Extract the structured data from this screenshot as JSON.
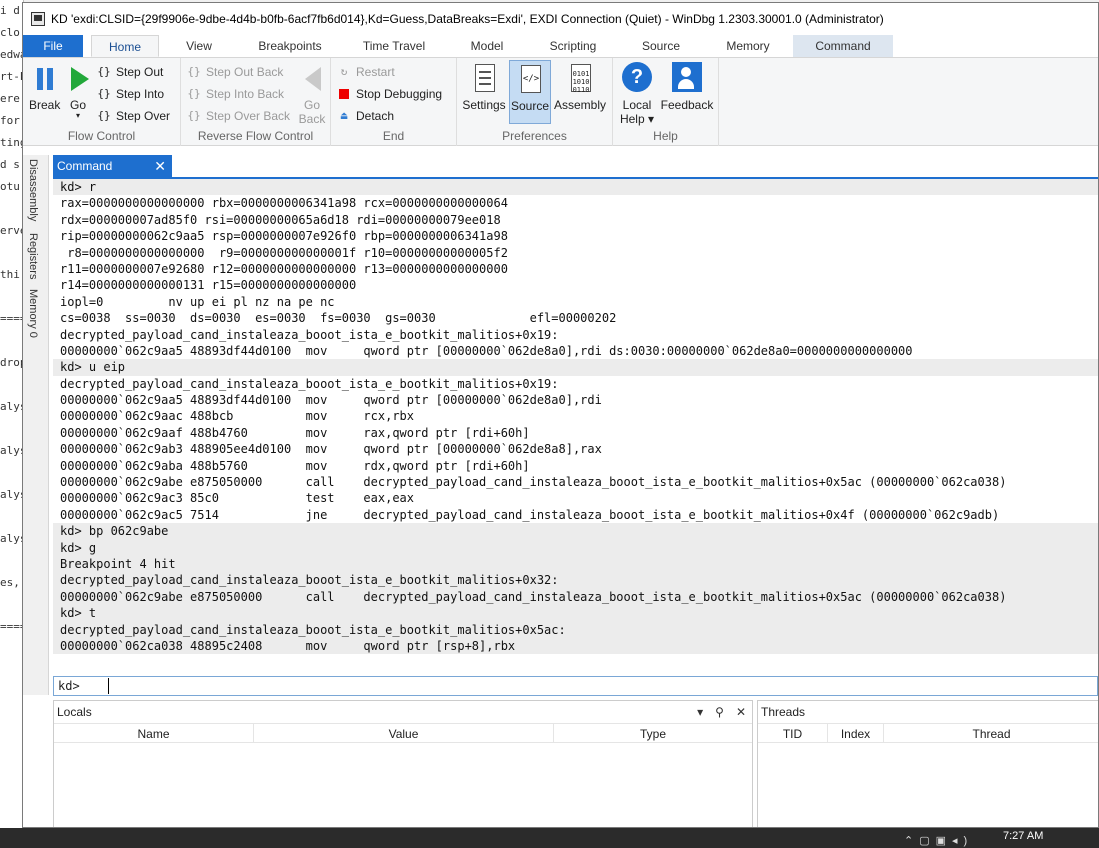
{
  "background_window": {
    "lines": [
      "i d",
      "clo",
      "edwa",
      "rt-E",
      "ere",
      "for",
      "ting",
      "d s",
      "otu",
      "",
      "erve",
      "",
      "thi",
      "",
      "====",
      "",
      "drop",
      "",
      "alys",
      "",
      "alys",
      "",
      "alys",
      "",
      "alys",
      "",
      "es,",
      "",
      "===="
    ]
  },
  "window": {
    "title": "KD 'exdi:CLSID={29f9906e-9dbe-4d4b-b0fb-6acf7fb6d014},Kd=Guess,DataBreaks=Exdi', EXDI Connection (Quiet) - WinDbg 1.2303.30001.0 (Administrator)"
  },
  "ribbon_tabs": [
    "File",
    "Home",
    "View",
    "Breakpoints",
    "Time Travel",
    "Model",
    "Scripting",
    "Source",
    "Memory",
    "Command"
  ],
  "ribbon": {
    "flow_control": {
      "label": "Flow Control",
      "break": "Break",
      "go": "Go",
      "step_out": "Step Out",
      "step_into": "Step Into",
      "step_over": "Step Over"
    },
    "reverse_flow_control": {
      "label": "Reverse Flow Control",
      "step_out_back": "Step Out Back",
      "step_into_back": "Step Into Back",
      "step_over_back": "Step Over Back",
      "go_back_1": "Go",
      "go_back_2": "Back"
    },
    "end": {
      "label": "End",
      "restart": "Restart",
      "stop_debugging": "Stop Debugging",
      "detach": "Detach"
    },
    "preferences": {
      "label": "Preferences",
      "settings": "Settings",
      "source": "Source",
      "assembly": "Assembly"
    },
    "help": {
      "label": "Help",
      "local_help_1": "Local",
      "local_help_2": "Help ▾",
      "feedback": "Feedback"
    }
  },
  "side_tabs": [
    "Disassembly",
    "Registers",
    "Memory 0"
  ],
  "command_panel": {
    "title": "Command",
    "prompt": "kd>",
    "output": [
      {
        "t": "kd> r",
        "cmd": true
      },
      {
        "t": "rax=0000000000000000 rbx=0000000006341a98 rcx=0000000000000064",
        "cmd": false
      },
      {
        "t": "rdx=000000007ad85f0 rsi=00000000065a6d18 rdi=00000000079ee018",
        "cmd": false
      },
      {
        "t": "rip=00000000062c9aa5 rsp=0000000007e926f0 rbp=0000000006341a98",
        "cmd": false
      },
      {
        "t": " r8=0000000000000000  r9=000000000000001f r10=00000000000005f2",
        "cmd": false
      },
      {
        "t": "r11=0000000007e92680 r12=0000000000000000 r13=0000000000000000",
        "cmd": false
      },
      {
        "t": "r14=0000000000000131 r15=0000000000000000",
        "cmd": false
      },
      {
        "t": "iopl=0         nv up ei pl nz na pe nc",
        "cmd": false
      },
      {
        "t": "cs=0038  ss=0030  ds=0030  es=0030  fs=0030  gs=0030             efl=00000202",
        "cmd": false
      },
      {
        "t": "decrypted_payload_cand_instaleaza_booot_ista_e_bootkit_malitios+0x19:",
        "cmd": false
      },
      {
        "t": "00000000`062c9aa5 48893df44d0100  mov     qword ptr [00000000`062de8a0],rdi ds:0030:00000000`062de8a0=0000000000000000",
        "cmd": false
      },
      {
        "t": "kd> u eip",
        "cmd": true
      },
      {
        "t": "decrypted_payload_cand_instaleaza_booot_ista_e_bootkit_malitios+0x19:",
        "cmd": false
      },
      {
        "t": "00000000`062c9aa5 48893df44d0100  mov     qword ptr [00000000`062de8a0],rdi",
        "cmd": false
      },
      {
        "t": "00000000`062c9aac 488bcb          mov     rcx,rbx",
        "cmd": false
      },
      {
        "t": "00000000`062c9aaf 488b4760        mov     rax,qword ptr [rdi+60h]",
        "cmd": false
      },
      {
        "t": "00000000`062c9ab3 488905ee4d0100  mov     qword ptr [00000000`062de8a8],rax",
        "cmd": false
      },
      {
        "t": "00000000`062c9aba 488b5760        mov     rdx,qword ptr [rdi+60h]",
        "cmd": false
      },
      {
        "t": "00000000`062c9abe e875050000      call    decrypted_payload_cand_instaleaza_booot_ista_e_bootkit_malitios+0x5ac (00000000`062ca038)",
        "cmd": false
      },
      {
        "t": "00000000`062c9ac3 85c0            test    eax,eax",
        "cmd": false
      },
      {
        "t": "00000000`062c9ac5 7514            jne     decrypted_payload_cand_instaleaza_booot_ista_e_bootkit_malitios+0x4f (00000000`062c9adb)",
        "cmd": false
      },
      {
        "t": "kd> bp 062c9abe",
        "cmd": true
      },
      {
        "t": "kd> g",
        "cmd": true
      },
      {
        "t": "Breakpoint 4 hit",
        "cmd": true
      },
      {
        "t": "decrypted_payload_cand_instaleaza_booot_ista_e_bootkit_malitios+0x32:",
        "cmd": true
      },
      {
        "t": "00000000`062c9abe e875050000      call    decrypted_payload_cand_instaleaza_booot_ista_e_bootkit_malitios+0x5ac (00000000`062ca038)",
        "cmd": true
      },
      {
        "t": "kd> t",
        "cmd": true
      },
      {
        "t": "decrypted_payload_cand_instaleaza_booot_ista_e_bootkit_malitios+0x5ac:",
        "cmd": true
      },
      {
        "t": "00000000`062ca038 48895c2408      mov     qword ptr [rsp+8],rbx",
        "cmd": true
      }
    ]
  },
  "locals_panel": {
    "title": "Locals",
    "columns": [
      "Name",
      "Value",
      "Type"
    ]
  },
  "threads_panel": {
    "title": "Threads",
    "columns": [
      "TID",
      "Index",
      "Thread"
    ]
  },
  "taskbar": {
    "time": "7:27 AM"
  }
}
